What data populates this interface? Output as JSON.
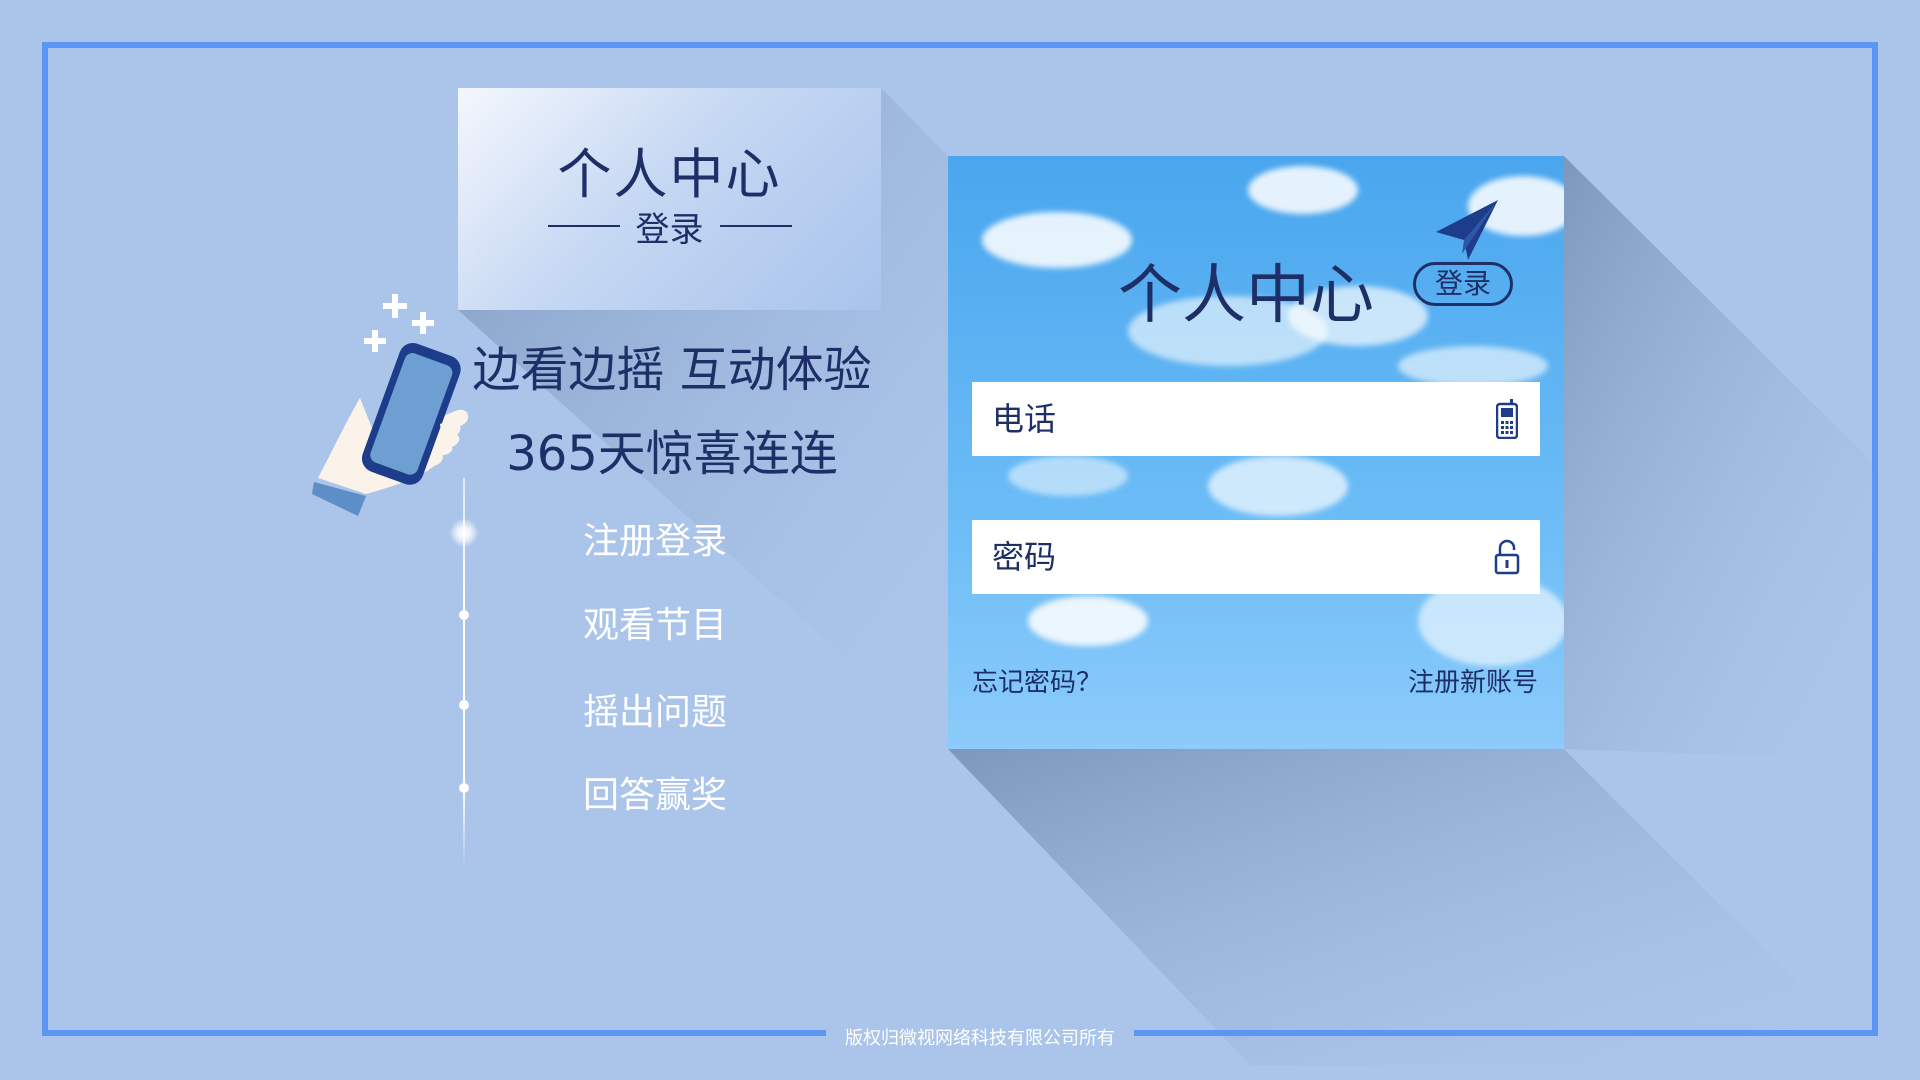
{
  "header": {
    "title": "个人中心",
    "subtitle": "登录"
  },
  "promo": {
    "line1": "边看边摇 互动体验",
    "line2": "365天惊喜连连"
  },
  "timeline": {
    "items": [
      {
        "label": "注册登录"
      },
      {
        "label": "观看节目"
      },
      {
        "label": "摇出问题"
      },
      {
        "label": "回答赢奖"
      }
    ]
  },
  "login": {
    "title": "个人中心",
    "badge": "登录",
    "phone_placeholder": "电话",
    "password_placeholder": "密码",
    "forgot_link": "忘记密码？",
    "register_link": "注册新账号"
  },
  "footer": {
    "copyright": "版权归微视网络科技有限公司所有"
  },
  "icons": {
    "phone_field": "mobile-phone-icon",
    "password_field": "unlock-icon",
    "plane": "paper-plane-icon",
    "illustration": "hand-holding-phone-icon"
  },
  "colors": {
    "background": "#aac4ea",
    "frame": "#5d96f2",
    "text_dark": "#1d2f66",
    "panel_sky": "#4aa6ee"
  }
}
